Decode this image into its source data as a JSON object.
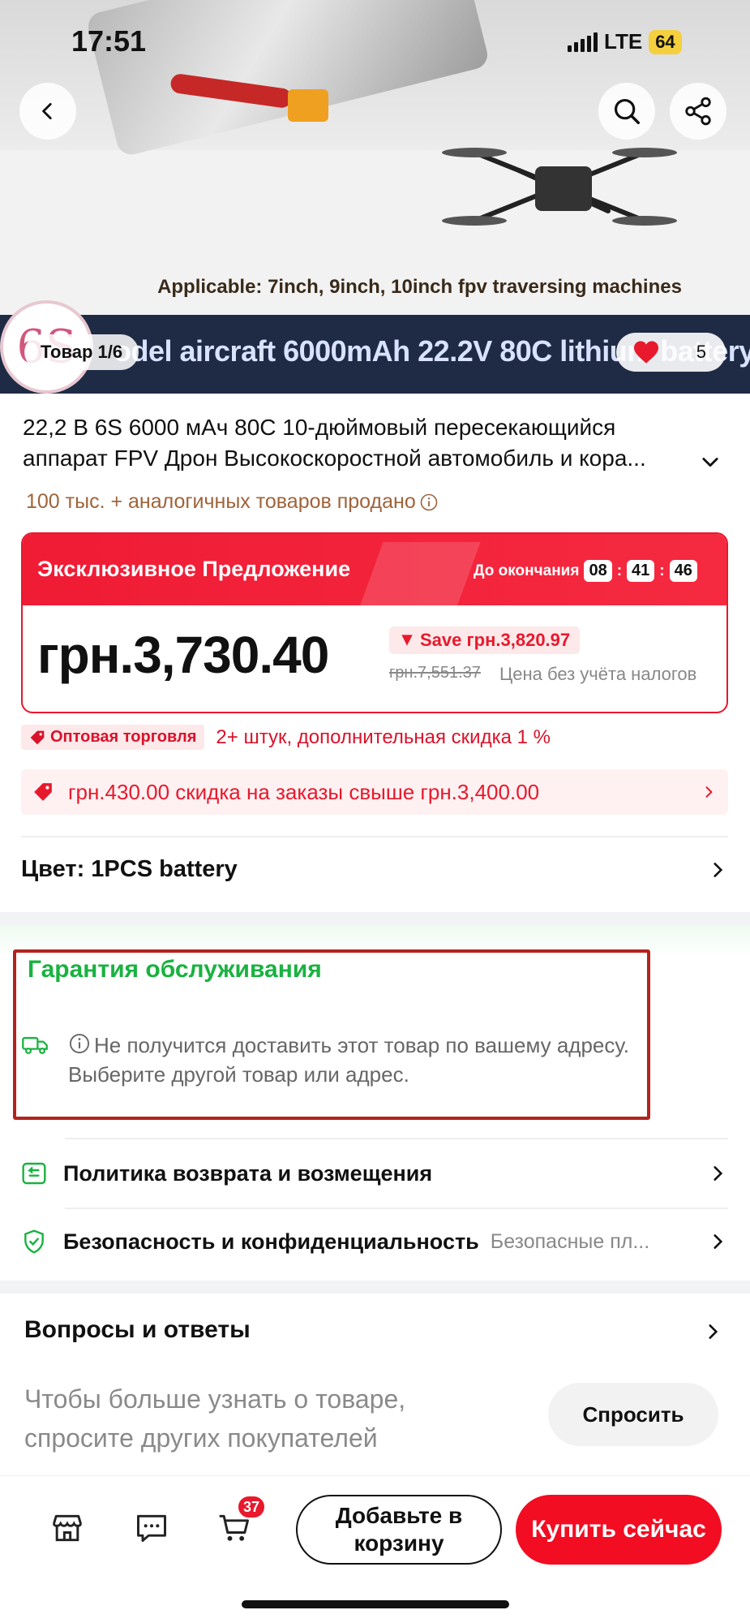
{
  "status_bar": {
    "time": "17:51",
    "network": "LTE",
    "battery": "64"
  },
  "hero": {
    "logo_text": "6S",
    "caption": "Applicable: 7inch, 9inch, 10inch fpv traversing machines",
    "banner_text": "odel aircraft 6000mAh 22.2V 80C lithium battery",
    "counter": "Товар 1/6",
    "likes": "5"
  },
  "product": {
    "title": "22,2 В 6S 6000 мАч 80C 10-дюймовый пересекающийся аппарат FPV Дрон Высокоскоростной автомобиль и кора...",
    "sold": "100 тыс. + аналогичных товаров продано"
  },
  "price_card": {
    "exclusive_label": "Эксклюзивное Предложение",
    "ends_label": "До окончания",
    "timer": [
      "08",
      "41",
      "46"
    ],
    "price": "грн.3,730.40",
    "save": "Save грн.3,820.97",
    "old_price": "грн.7,551.37",
    "tax_note": "Цена без учёта налогов"
  },
  "wholesale": {
    "tag": "Оптовая торговля",
    "text": "2+ штук, дополнительная скидка 1 %"
  },
  "discount": {
    "text": "грн.430.00 скидка на заказы свыше грн.3,400.00"
  },
  "color": {
    "label": "Цвет: 1PCS battery"
  },
  "guarantee": {
    "title": "Гарантия обслуживания",
    "delivery_warning": "Не получится доставить этот товар по вашему адресу. Выберите другой товар или адрес."
  },
  "policies": [
    {
      "label": "Политика возврата и возмещения",
      "sub": ""
    },
    {
      "label": "Безопасность и конфиденциальность",
      "sub": "Безопасные пл..."
    }
  ],
  "qa": {
    "title": "Вопросы и ответы",
    "prompt": "Чтобы больше узнать о товаре, спросите других покупателей",
    "ask_button": "Спросить"
  },
  "bottom_bar": {
    "cart_count": "37",
    "add_to_cart": "Добавьте в корзину",
    "buy_now": "Купить сейчас"
  },
  "colors": {
    "accent_red": "#e8192c",
    "guarantee_green": "#19b240",
    "sold_brown": "#a0633a"
  },
  "icons": [
    "back-arrow-icon",
    "search-icon",
    "share-icon",
    "heart-icon",
    "info-icon",
    "chevron-down-icon",
    "chevron-right-icon",
    "truck-icon",
    "return-icon",
    "shield-check-icon",
    "store-icon",
    "chat-icon",
    "cart-icon",
    "tag-icon",
    "gift-icon"
  ]
}
